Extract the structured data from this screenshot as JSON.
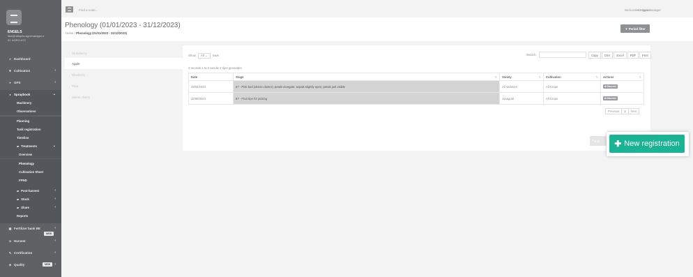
{
  "topbar": {
    "search_placeholder": "Find a node...",
    "welcome": "Welcome to Agromanager",
    "signout": "Signout"
  },
  "profile": {
    "name": "ENGELS",
    "email": "fast@ubispes.agromanager.e",
    "id": "ID: AGRO-672"
  },
  "sidebar": {
    "items": [
      {
        "label": "Dashboard",
        "icon": "hash-icon"
      },
      {
        "label": "Cultivation",
        "icon": "leaf-icon"
      },
      {
        "label": "GPS",
        "icon": "pin-icon"
      },
      {
        "label": "Spraybook",
        "icon": "drop-icon"
      }
    ],
    "spraybook_items": [
      "Machinery",
      "Observations",
      "Planning",
      "Tank registration",
      "Timeline"
    ],
    "treatments": {
      "label": "Treatments",
      "items": [
        "Overview",
        "Phenology",
        "Cultivation Sheet",
        "FPND"
      ]
    },
    "folders": [
      "Post-harvest",
      "Stock",
      "Share"
    ],
    "reports": "Reports",
    "fertilizer": {
      "label": "Fertilizer bank BE",
      "badge": "NEW"
    },
    "bottom_items": [
      "Harvest",
      "Certification",
      "Quality"
    ],
    "quality_badge": "NEW"
  },
  "header": {
    "title": "Phenology (01/01/2023 - 31/12/2023)",
    "breadcrumb_home": "Home",
    "breadcrumb_current": "Phenology (01/01/2023 - 31/12/2023)",
    "period_filter": "Period filter"
  },
  "crop_tabs": [
    "Strawberry",
    "Apple",
    "Blueberry",
    "Pear",
    "Sweet cherry"
  ],
  "table_controls": {
    "show": "Show",
    "entries_value": "All",
    "entries_suffix": "rows",
    "search_label": "Search:",
    "buttons": [
      "Copy",
      "CSV",
      "Excel",
      "PDF",
      "Print"
    ],
    "info": "2 records 1 to 2 van de 2 rijen gevonden"
  },
  "table": {
    "headers": [
      "Date",
      "Stage",
      "Variety",
      "Cultivation",
      "Actions"
    ],
    "rows": [
      {
        "date": "28/04/2023",
        "stage": "57 - Pink bud (dense cluster): petals elongate; sepals slightly open; petals just visible",
        "variety": "All Varieties",
        "cultivation": "All Crops",
        "action": "Harvest"
      },
      {
        "date": "22/08/2023",
        "stage": "87 - Fruit ripe for picking",
        "variety": "Jonagold",
        "cultivation": "All Crops",
        "action": "Harvest"
      }
    ]
  },
  "pager": {
    "prev": "Previous",
    "page": "1",
    "next": "Next"
  },
  "edit_label": "Edit",
  "new_registration": "New registration",
  "colors": {
    "accent": "#1ab394",
    "sidebar": "#5f6164"
  }
}
